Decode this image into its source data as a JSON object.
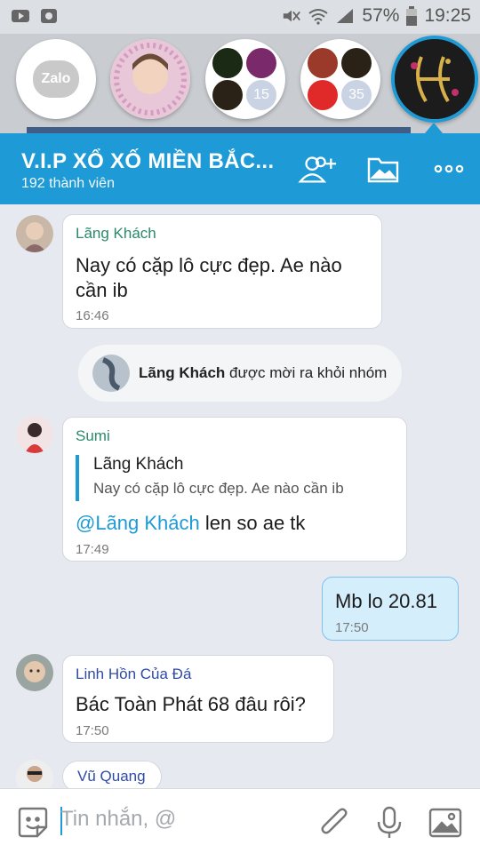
{
  "statusbar": {
    "battery": "57%",
    "time": "19:25"
  },
  "chatheads": {
    "zalo_label": "Zalo",
    "group1_badge": "15",
    "group2_badge": "35"
  },
  "header": {
    "title": "V.I.P XỔ XỐ MIỀN BẮC...",
    "subtitle": "192 thành viên"
  },
  "messages": [
    {
      "sender": "Lãng Khách",
      "lines": [
        "Nay có cặp lô cực đẹp. Ae nào",
        "cần ib"
      ],
      "time": "16:46"
    },
    {
      "system_name": "Lãng Khách",
      "system_text": " được mời ra khỏi nhóm"
    },
    {
      "sender": "Sumi",
      "quote_name": "Lãng Khách",
      "quote_text": "Nay có cặp lô cực đẹp. Ae nào cần ib",
      "mention": "@Lãng Khách",
      "text": " len so ae tk",
      "time": "17:49"
    },
    {
      "text": "Mb lo 20.81",
      "time": "17:50"
    },
    {
      "sender": "Linh Hồn Của Đá",
      "text": "Bác Toàn Phát 68 đâu rôi?",
      "time": "17:50"
    },
    {
      "sender": "Vũ Quang"
    }
  ],
  "input": {
    "placeholder": "Tin nhắn, @"
  },
  "colors": {
    "accent": "#1e9ad6",
    "sender_green": "#2a8a6a",
    "sender_blue": "#2f4aa8"
  }
}
